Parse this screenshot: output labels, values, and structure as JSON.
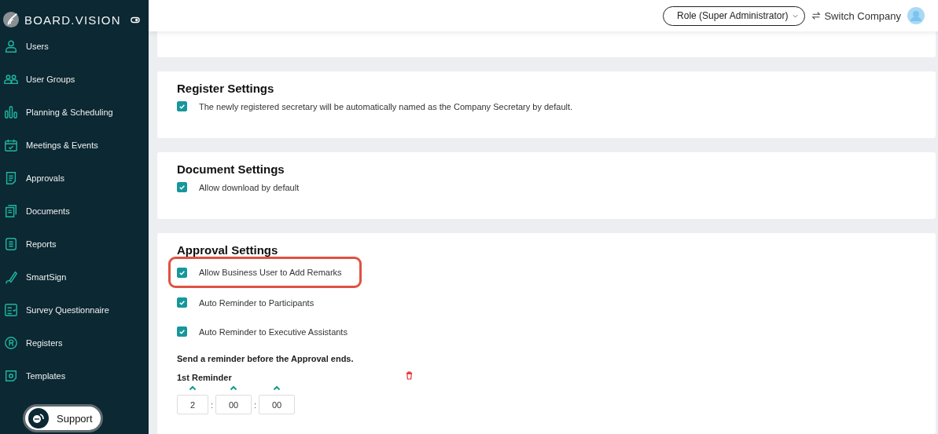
{
  "brand": {
    "name": "BOARD.VISION"
  },
  "sidebar": {
    "items": [
      {
        "label": "Users"
      },
      {
        "label": "User Groups"
      },
      {
        "label": "Planning & Scheduling"
      },
      {
        "label": "Meetings & Events"
      },
      {
        "label": "Approvals"
      },
      {
        "label": "Documents"
      },
      {
        "label": "Reports"
      },
      {
        "label": "SmartSign"
      },
      {
        "label": "Survey Questionnaire"
      },
      {
        "label": "Registers"
      },
      {
        "label": "Templates"
      }
    ]
  },
  "support": {
    "label": "Support"
  },
  "header": {
    "role": "Role (Super Administrator)",
    "switch_company": "Switch Company"
  },
  "sections": [
    {
      "title": "Register Settings",
      "options": [
        {
          "label": "The newly registered secretary will be automatically named as the Company Secretary by default.",
          "checked": true,
          "highlighted": false
        }
      ]
    },
    {
      "title": "Document Settings",
      "options": [
        {
          "label": "Allow download by default",
          "checked": true,
          "highlighted": false
        }
      ]
    },
    {
      "title": "Approval Settings",
      "options": [
        {
          "label": "Allow Business User to Add Remarks",
          "checked": true,
          "highlighted": true
        },
        {
          "label": "Auto Reminder to Participants",
          "checked": true,
          "highlighted": false
        },
        {
          "label": "Auto Reminder to Executive Assistants",
          "checked": true,
          "highlighted": false
        }
      ],
      "reminder": {
        "heading": "Send a reminder before the Approval ends.",
        "label": "1st Reminder",
        "fields": [
          "2",
          "00",
          "00"
        ],
        "separator": ":"
      }
    }
  ]
}
